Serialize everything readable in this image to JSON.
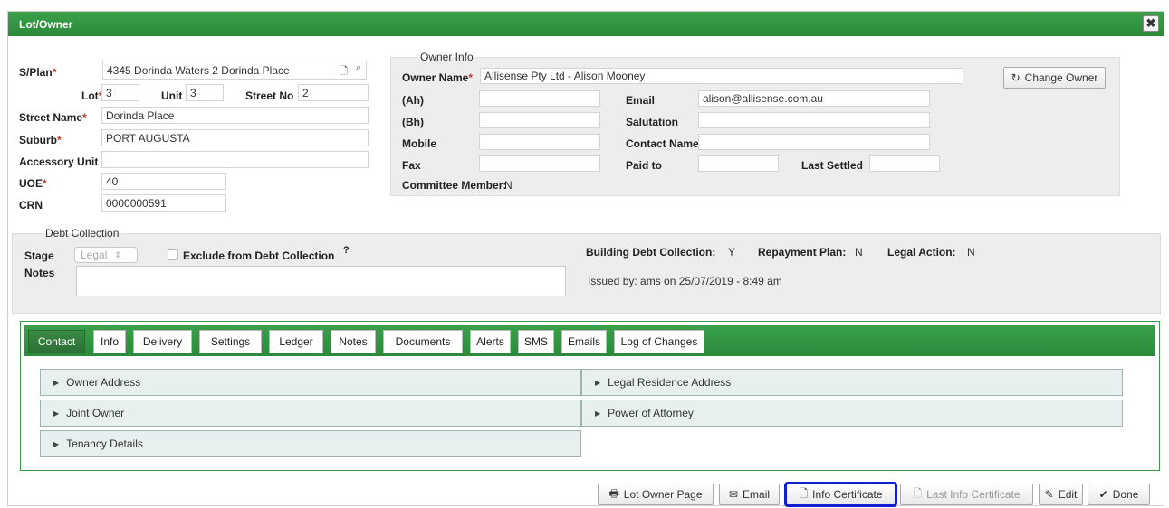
{
  "window": {
    "title": "Lot/Owner",
    "close_glyph": "✖"
  },
  "lot": {
    "splan_label": "S/Plan",
    "splan_value": "4345 Dorinda Waters 2 Dorinda Place",
    "lot_label": "Lot",
    "lot_value": "3",
    "unit_label": "Unit",
    "unit_value": "3",
    "street_no_label": "Street No",
    "street_no_value": "2",
    "street_name_label": "Street Name",
    "street_name_value": "Dorinda Place",
    "suburb_label": "Suburb",
    "suburb_value": "PORT AUGUSTA",
    "accessory_label": "Accessory Unit",
    "accessory_value": "",
    "uoe_label": "UOE",
    "uoe_value": "40",
    "crn_label": "CRN",
    "crn_value": "0000000591"
  },
  "owner": {
    "legend": "Owner Info",
    "name_label": "Owner Name",
    "name_value": "Allisense Pty Ltd - Alison Mooney",
    "change_owner": "Change Owner",
    "ah_label": "(Ah)",
    "bh_label": "(Bh)",
    "mobile_label": "Mobile",
    "fax_label": "Fax",
    "email_label": "Email",
    "email_value": "alison@allisense.com.au",
    "salutation_label": "Salutation",
    "contact_label": "Contact Name",
    "paid_to_label": "Paid to",
    "last_settled_label": "Last Settled",
    "committee_label": "Committee Member:",
    "committee_value": "N"
  },
  "debt": {
    "legend": "Debt Collection",
    "stage_label": "Stage",
    "stage_value": "Legal",
    "exclude_label": "Exclude from Debt Collection",
    "help_glyph": "?",
    "notes_label": "Notes",
    "building_label": "Building Debt Collection:",
    "building_value": "Y",
    "repayment_label": "Repayment Plan:",
    "repayment_value": "N",
    "legal_label": "Legal Action:",
    "legal_value": "N",
    "issued": "Issued by: ams on 25/07/2019 - 8:49 am"
  },
  "tabs": [
    "Contact",
    "Info",
    "Delivery",
    "Settings",
    "Ledger",
    "Notes",
    "Documents",
    "Alerts",
    "SMS",
    "Emails",
    "Log of Changes"
  ],
  "accordions": {
    "owner_address": "Owner Address",
    "legal_residence": "Legal Residence Address",
    "joint_owner": "Joint Owner",
    "power_attorney": "Power of Attorney",
    "tenancy": "Tenancy Details"
  },
  "footer": {
    "lot_owner_page": "Lot Owner Page",
    "email": "Email",
    "info_certificate": "Info Certificate",
    "last_info_certificate": "Last Info Certificate",
    "edit": "Edit",
    "done": "Done"
  }
}
